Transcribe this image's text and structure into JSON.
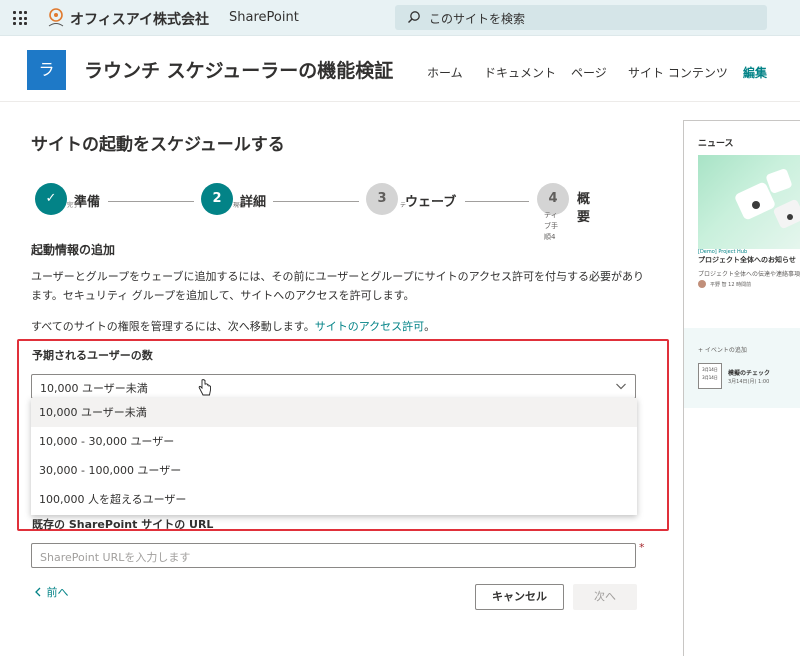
{
  "suite": {
    "company": "オフィスアイ株式会社",
    "app": "SharePoint",
    "search_placeholder": "このサイトを検索"
  },
  "site": {
    "logo_letter": "ラ",
    "title": "ラウンチ スケジューラーの機能検証",
    "nav": [
      "ホーム",
      "ドキュメント",
      "ページ",
      "サイト コンテンツ",
      "編集"
    ]
  },
  "main": {
    "heading": "サイトの起動をスケジュールする",
    "steps": [
      {
        "number": "✓",
        "label": "準備",
        "state": "done",
        "tiny": "完了"
      },
      {
        "number": "2",
        "label": "詳細",
        "state": "active",
        "tiny": "現在"
      },
      {
        "number": "3",
        "label": "ウェーブ",
        "state": "todo",
        "tiny": "テ"
      },
      {
        "number": "4",
        "label": "概要",
        "state": "todo",
        "tiny": ""
      }
    ],
    "step_sub_text": "ティブ手順4",
    "section_title": "起動情報の追加",
    "para1": "ユーザーとグループをウェーブに追加するには、その前にユーザーとグループにサイトのアクセス許可を付与する必要があります。セキュリティ グループを追加して、サイトへのアクセスを許可します。",
    "para2_text": "すべてのサイトの権限を管理するには、次へ移動します。",
    "para2_link": "サイトのアクセス許可",
    "para2_end": "。",
    "users_label": "予期されるユーザーの数",
    "users_selected": "10,000 ユーザー未満",
    "users_options": [
      "10,000 ユーザー未満",
      "10,000 - 30,000 ユーザー",
      "30,000 - 100,000 ユーザー",
      "100,000 人を超えるユーザー"
    ],
    "url_label": "既存の SharePoint サイトの URL",
    "url_placeholder": "SharePoint URLを入力します",
    "required_mark": "*",
    "back": "前へ",
    "cancel": "キャンセル",
    "next": "次へ"
  },
  "news": {
    "title": "ニュース",
    "tag": "[Demo] Project Hub",
    "headline": "プロジェクト全体へのお知らせ",
    "description": "プロジェクト全体への伝達や連絡事項",
    "author": "平野 智 12 時間前",
    "add_event": "+ イベントの追加",
    "event_date_1": "3月14日",
    "event_date_2": "3月14日",
    "event_name": "模擬のチェック",
    "event_time": "3月14日(月) 1:00"
  },
  "colors": {
    "accent": "#038387",
    "highlight_box": "#e0303a",
    "site_logo": "#1e79c7"
  }
}
